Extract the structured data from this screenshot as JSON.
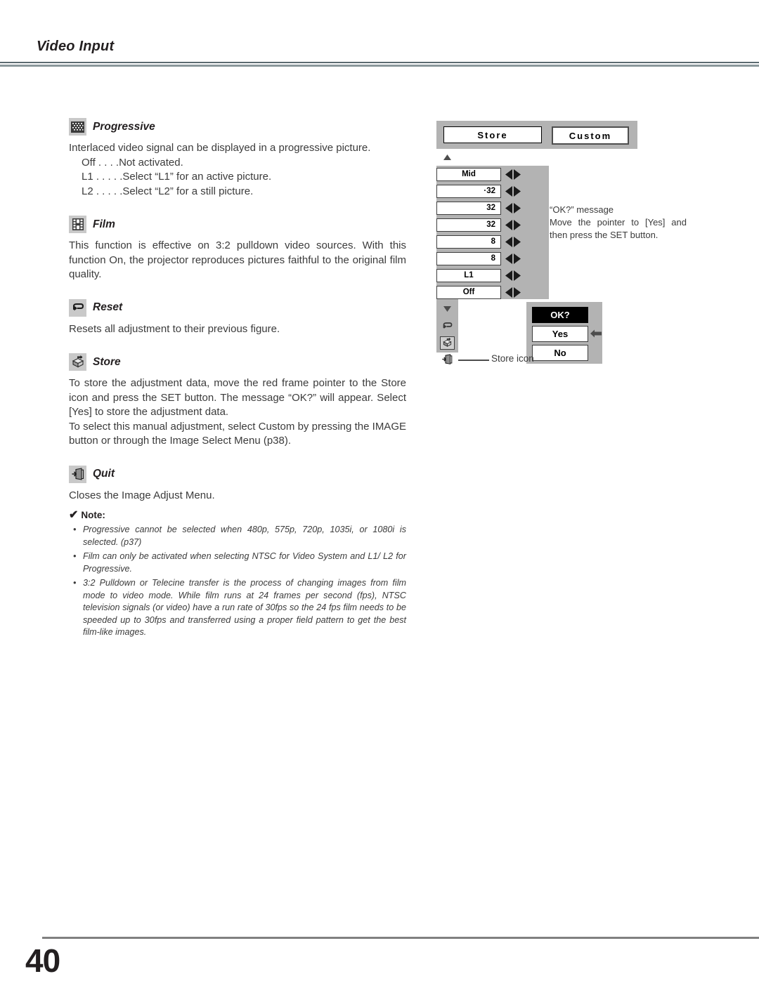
{
  "header": {
    "title": "Video Input"
  },
  "footer": {
    "page_number": "40"
  },
  "sections": [
    {
      "id": "progressive",
      "icon": "progressive-grid-icon",
      "title": "Progressive",
      "paragraphs": [
        "Interlaced video signal can be displayed in a progressive picture."
      ],
      "options": [
        "Off  . . . .Not activated.",
        "L1 . . . . .Select “L1” for an active picture.",
        "L2 . . . . .Select “L2” for a still picture."
      ]
    },
    {
      "id": "film",
      "icon": "film-strip-icon",
      "title": "Film",
      "paragraphs": [
        "This function is effective on 3:2 pulldown video sources.  With this function On, the projector reproduces pictures faithful to the original film quality."
      ],
      "options": []
    },
    {
      "id": "reset",
      "icon": "undo-arrow-icon",
      "title": "Reset",
      "paragraphs": [
        "Resets all adjustment to their previous figure."
      ],
      "options": []
    },
    {
      "id": "store",
      "icon": "store-box-icon",
      "title": "Store",
      "paragraphs": [
        "To store the adjustment data, move the red frame pointer to the Store icon and press the SET button. The message “OK?” will appear.  Select [Yes] to store the adjustment data.",
        "To select this manual adjustment, select Custom by pressing the IMAGE button or through the Image Select Menu (p38)."
      ],
      "options": []
    },
    {
      "id": "quit",
      "icon": "exit-door-icon",
      "title": "Quit",
      "paragraphs": [
        "Closes the Image Adjust Menu."
      ],
      "options": []
    }
  ],
  "note": {
    "check_glyph": "✔",
    "label": "Note:",
    "items": [
      "Progressive cannot be selected when 480p, 575p, 720p, 1035i, or 1080i  is selected.  (p37)",
      "Film can only be activated when selecting NTSC for Video System and L1/ L2 for Progressive.",
      "3:2 Pulldown or Telecine transfer is the process of changing images from film mode to video mode.  While film runs at 24 frames per second (fps), NTSC television signals (or video) have a run rate of 30fps so the 24 fps film needs to be speeded up to 30fps and transferred using a proper field pattern to get the best film-like images."
    ]
  },
  "osd": {
    "tabs": [
      {
        "label": "Store",
        "selected": false
      },
      {
        "label": "Custom",
        "selected": true
      }
    ],
    "rail_icons": [
      "scroll-up-triangle-icon",
      "color-level-icon",
      "red-balance-icon",
      "green-balance-icon",
      "blue-balance-icon",
      "contrast-icon",
      "sharpness-icon",
      "progressive-grid-icon",
      "film-strip-icon",
      "scroll-down-triangle-icon",
      "undo-arrow-icon",
      "store-box-icon",
      "exit-door-icon"
    ],
    "fields": [
      {
        "icon": "color-level-icon",
        "value": "Mid",
        "align": "center"
      },
      {
        "icon": "red-balance-icon",
        "value": "·32",
        "align": "right"
      },
      {
        "icon": "green-balance-icon",
        "value": "32",
        "align": "right"
      },
      {
        "icon": "blue-balance-icon",
        "value": "32",
        "align": "right"
      },
      {
        "icon": "contrast-icon",
        "value": "8",
        "align": "right"
      },
      {
        "icon": "sharpness-icon",
        "value": "8",
        "align": "right"
      },
      {
        "icon": "progressive-grid-icon",
        "value": "L1",
        "align": "center"
      },
      {
        "icon": "film-strip-icon",
        "value": "Off",
        "align": "center"
      }
    ],
    "dialog": {
      "title": "OK?",
      "yes_label": "Yes",
      "no_label": "No"
    },
    "callout": [
      "“OK?” message",
      "Move the pointer to [Yes] and then press the SET button."
    ],
    "store_icon_label": "Store icon"
  },
  "colors": {
    "panel_gray": "#b3b3b3",
    "rule_gray": "#808080",
    "header_rule": "#5c6b70",
    "text": "#3b3b3b",
    "heading": "#231f20"
  }
}
